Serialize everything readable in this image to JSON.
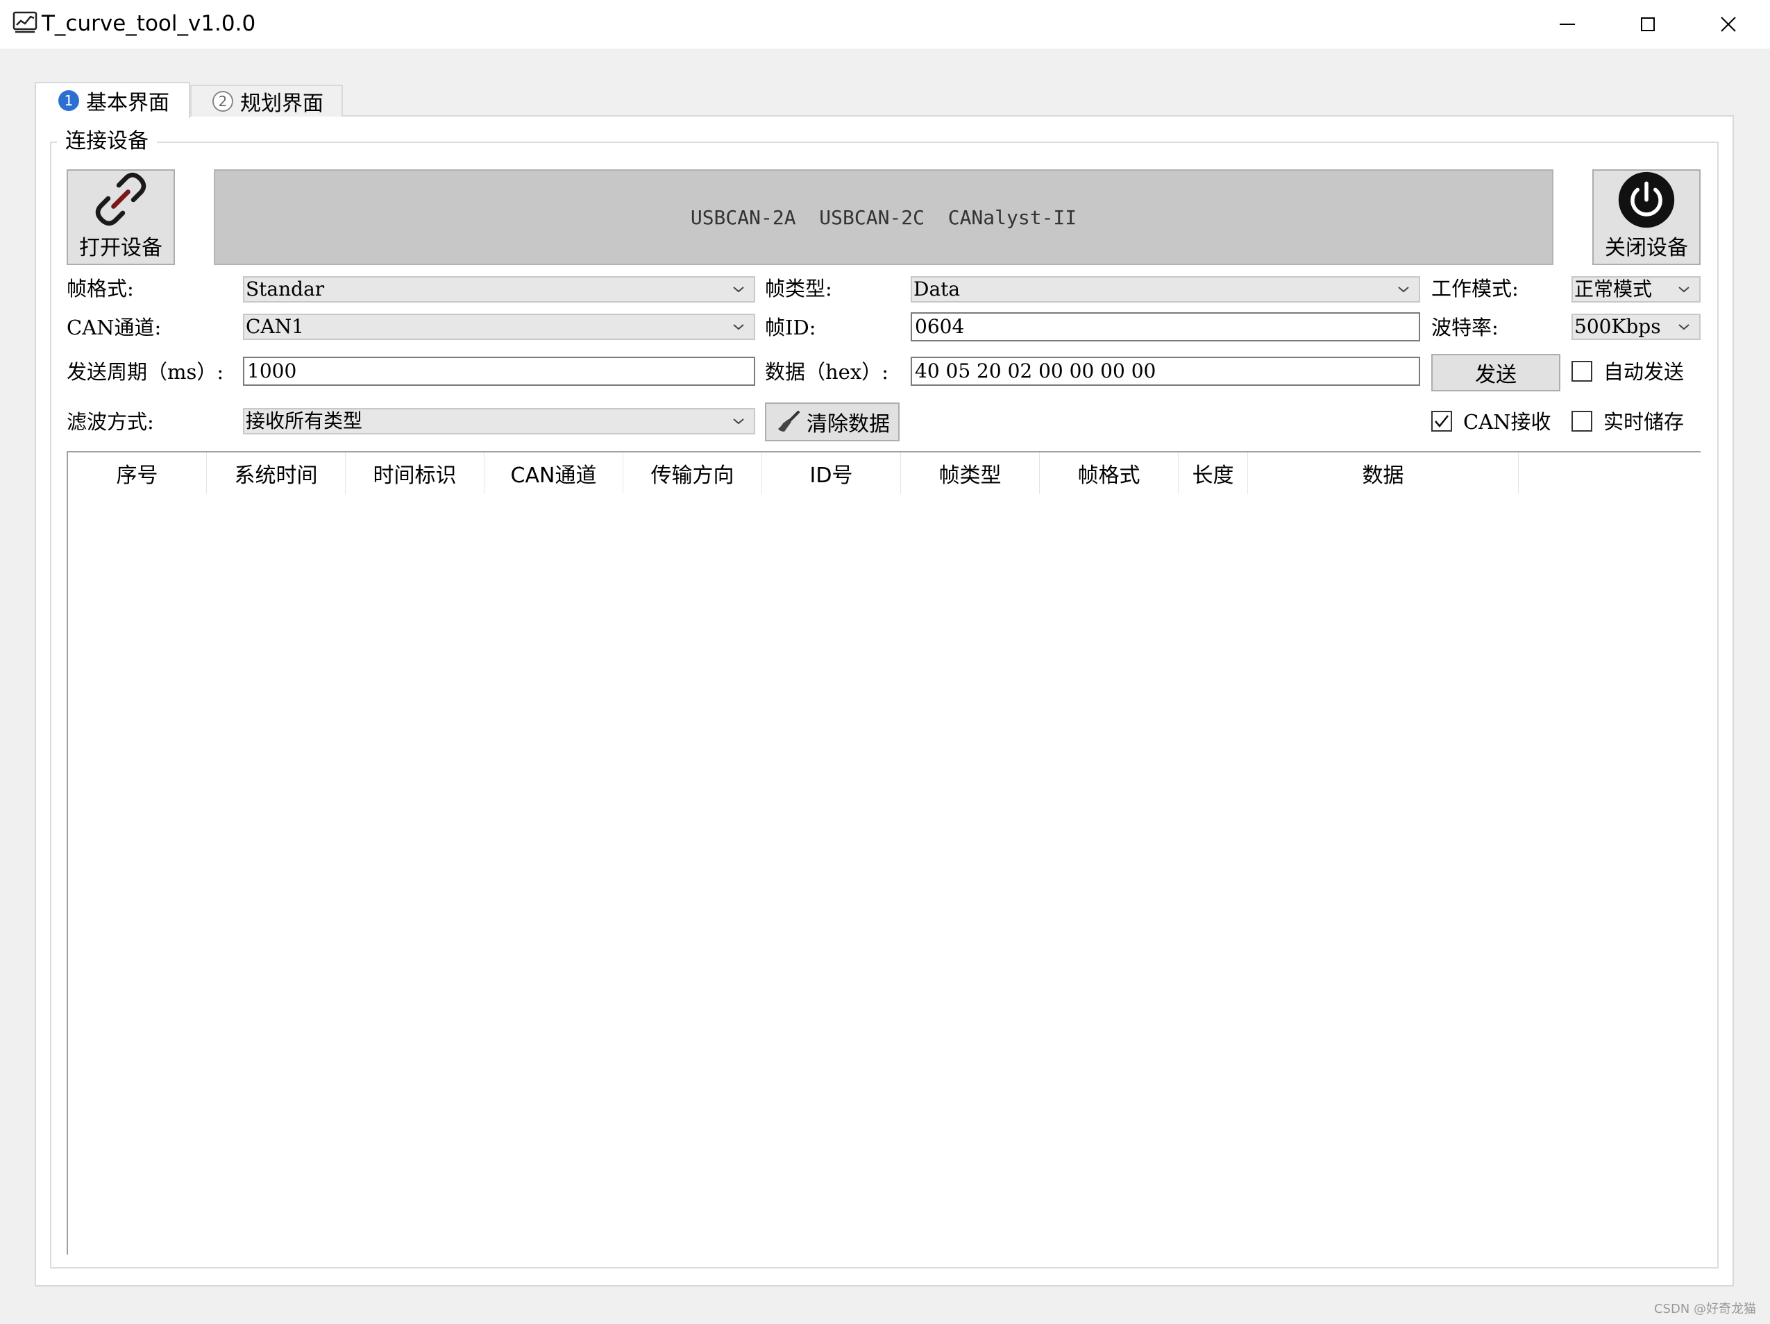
{
  "window": {
    "title": "T_curve_tool_v1.0.0",
    "controls": {
      "minimize": "minimize-icon",
      "maximize": "maximize-icon",
      "close": "close-icon"
    }
  },
  "tabs": [
    {
      "num": "1",
      "label": "基本界面",
      "active": true
    },
    {
      "num": "2",
      "label": "规划界面",
      "active": false
    }
  ],
  "group": {
    "title": "连接设备"
  },
  "buttons": {
    "open_device": "打开设备",
    "close_device": "关闭设备",
    "send": "发送",
    "clear_data": "清除数据"
  },
  "device_list": {
    "text": "USBCAN-2A  USBCAN-2C  CANalyst-II"
  },
  "form": {
    "frame_format_label": "帧格式:",
    "frame_format_value": "Standar",
    "frame_type_label": "帧类型:",
    "frame_type_value": "Data",
    "work_mode_label": "工作模式:",
    "work_mode_value": "正常模式",
    "can_channel_label": "CAN通道:",
    "can_channel_value": "CAN1",
    "frame_id_label": "帧ID:",
    "frame_id_value": "0604",
    "baud_label": "波特率:",
    "baud_value": "500Kbps",
    "period_label": "发送周期（ms）:",
    "period_value": "1000",
    "data_label": "数据（hex）:",
    "data_value": "40 05 20 02 00 00 00 00",
    "filter_label": "滤波方式:",
    "filter_value": "接收所有类型"
  },
  "checkboxes": {
    "auto_send": {
      "label": "自动发送",
      "checked": false
    },
    "can_receive": {
      "label": "CAN接收",
      "checked": true
    },
    "realtime_save": {
      "label": "实时储存",
      "checked": false
    }
  },
  "table": {
    "columns": [
      "序号",
      "系统时间",
      "时间标识",
      "CAN通道",
      "传输方向",
      "ID号",
      "帧类型",
      "帧格式",
      "长度",
      "数据"
    ]
  },
  "watermark": "CSDN @好奇龙猫"
}
